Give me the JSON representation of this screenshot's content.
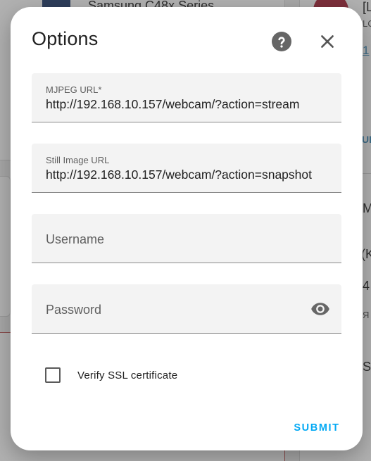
{
  "background": {
    "card_title": "Samsung C48x Series",
    "right_col": [
      "[L",
      "LC",
      "1",
      "UR",
      "M",
      "(K",
      "4",
      "Я",
      "S"
    ]
  },
  "dialog": {
    "title": "Options",
    "help_icon": "help-circle-icon",
    "close_icon": "close-icon",
    "fields": {
      "mjpeg_url": {
        "label": "MJPEG URL*",
        "value": "http://192.168.10.157/webcam/?action=stream"
      },
      "still_image_url": {
        "label": "Still Image URL",
        "value": "http://192.168.10.157/webcam/?action=snapshot"
      },
      "username": {
        "placeholder": "Username",
        "value": ""
      },
      "password": {
        "placeholder": "Password",
        "value": "",
        "toggle_icon": "eye-icon"
      }
    },
    "verify_ssl": {
      "label": "Verify SSL certificate",
      "checked": false
    },
    "submit_label": "SUBMIT"
  },
  "colors": {
    "accent": "#03a9f4",
    "dialog_bg": "#ffffff",
    "field_bg": "#f3f3f3",
    "icon_gray": "#666666"
  }
}
